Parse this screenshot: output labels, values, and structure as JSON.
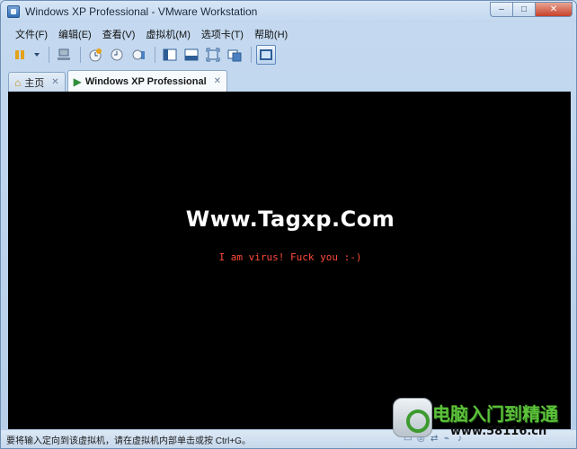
{
  "window": {
    "title": "Windows XP Professional - VMware Workstation",
    "controls": {
      "minimize": "–",
      "maximize": "□",
      "close": "✕"
    }
  },
  "menu": {
    "items": [
      {
        "label": "文件(F)"
      },
      {
        "label": "编辑(E)"
      },
      {
        "label": "查看(V)"
      },
      {
        "label": "虚拟机(M)"
      },
      {
        "label": "选项卡(T)"
      },
      {
        "label": "帮助(H)"
      }
    ]
  },
  "toolbar": {
    "icons": [
      "pause-icon",
      "dropdown-icon",
      "network-icon",
      "snapshot-take-icon",
      "snapshot-revert-icon",
      "snapshot-manager-icon",
      "sidebar-icon",
      "console-icon",
      "fullscreen-icon",
      "unity-icon",
      "console-view-icon"
    ]
  },
  "tabs": [
    {
      "label": "主页",
      "close": "✕",
      "active": false
    },
    {
      "label": "Windows XP Professional",
      "close": "✕",
      "active": true
    }
  ],
  "vm": {
    "headline": "Www.Tagxp.Com",
    "message": "I am virus! Fuck you :-)"
  },
  "status": {
    "text": "要将输入定向到该虚拟机，请在虚拟机内部单击或按 Ctrl+G。"
  },
  "watermark": {
    "title": "电脑入门到精通",
    "url": "www.58116.cn"
  }
}
